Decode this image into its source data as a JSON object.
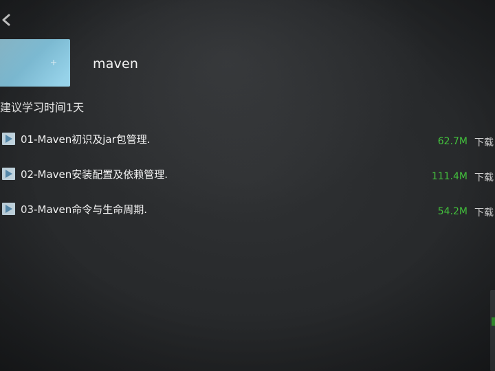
{
  "header": {
    "back_icon": "chevron-left-icon"
  },
  "course": {
    "cover_icon": "course-cover-thumbnail",
    "title": "maven",
    "study_time": "建议学习时间1天"
  },
  "lessons": [
    {
      "title": "01-Maven初识及jar包管理.",
      "size": "62.7M",
      "download": "下载"
    },
    {
      "title": "02-Maven安装配置及依赖管理.",
      "size": "111.4M",
      "download": "下载"
    },
    {
      "title": "03-Maven命令与生命周期.",
      "size": "54.2M",
      "download": "下载"
    }
  ],
  "colors": {
    "background": "#27292b",
    "text": "#f2f2f2",
    "size_green": "#43c13d",
    "cover_blue": "#8fcde6",
    "play_icon_bg": "#c9dde8"
  }
}
